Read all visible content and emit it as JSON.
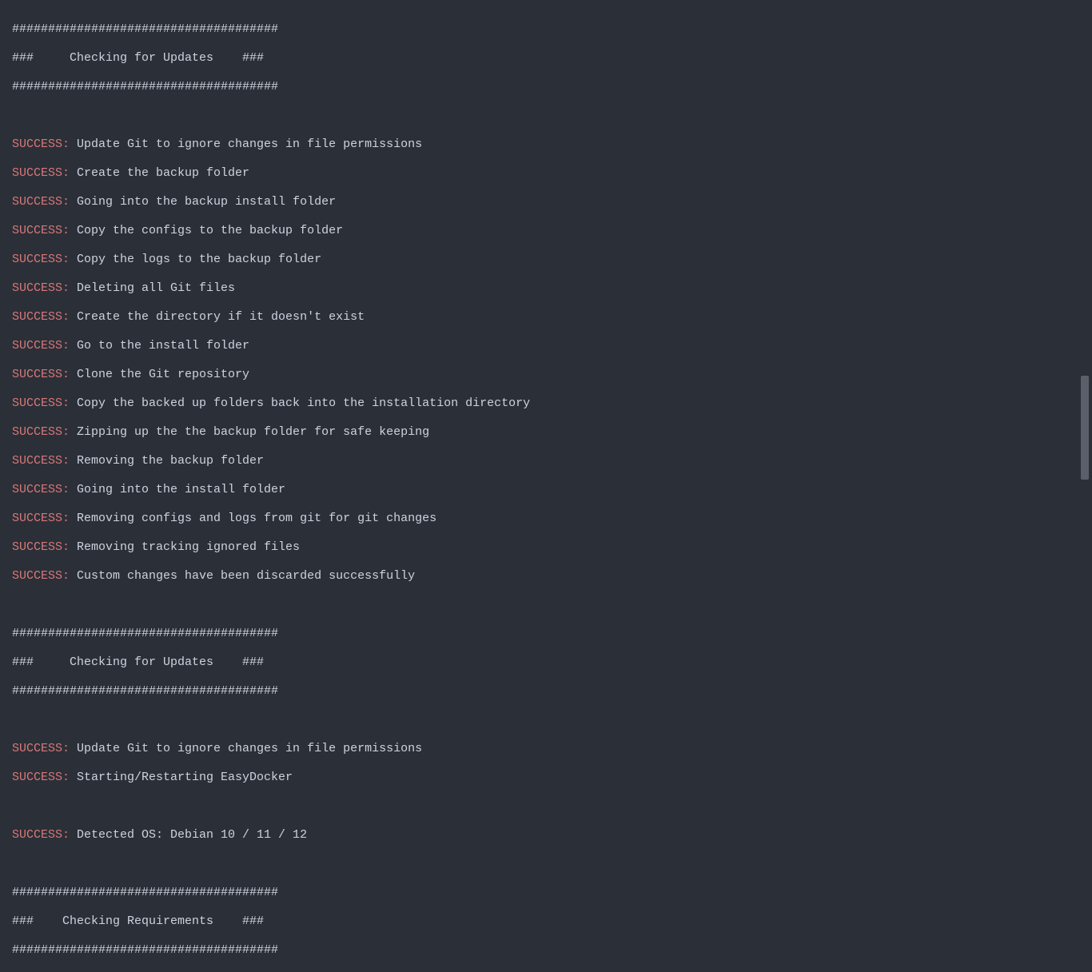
{
  "colors": {
    "background": "#2b2f38",
    "text": "#cdd3de",
    "success": "#d87878"
  },
  "labels": {
    "success": "SUCCESS:"
  },
  "banners": {
    "border": "#####################################",
    "checking_updates": "###     Checking for Updates    ###",
    "checking_requirements": "###    Checking Requirements    ###"
  },
  "messages": {
    "m1": " Update Git to ignore changes in file permissions",
    "m2": " Create the backup folder",
    "m3": " Going into the backup install folder",
    "m4": " Copy the configs to the backup folder",
    "m5": " Copy the logs to the backup folder",
    "m6": " Deleting all Git files",
    "m7": " Create the directory if it doesn't exist",
    "m8": " Go to the install folder",
    "m9": " Clone the Git repository",
    "m10": " Copy the backed up folders back into the installation directory",
    "m11": " Zipping up the the backup folder for safe keeping",
    "m12": " Removing the backup folder",
    "m13": " Going into the install folder",
    "m14": " Removing configs and logs from git for git changes",
    "m15": " Removing tracking ignored files",
    "m16": " Custom changes have been discarded successfully",
    "m17": " Update Git to ignore changes in file permissions",
    "m18": " Starting/Restarting EasyDocker",
    "m19": " Detected OS: Debian 10 / 11 / 12"
  }
}
